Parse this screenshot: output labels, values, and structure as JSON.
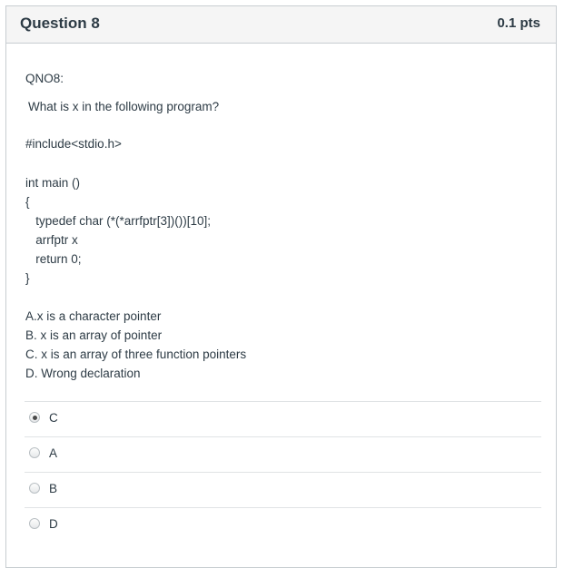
{
  "question": {
    "title": "Question 8",
    "points": "0.1 pts"
  },
  "content": {
    "qno": "QNO8:",
    "prompt": "What is x in the following program?",
    "include": "#include<stdio.h>",
    "code": [
      "int main ()",
      "{",
      "   typedef char (*(*arrfptr[3])())[10];",
      "   arrfptr x",
      "   return 0;",
      "}"
    ],
    "options_text": [
      "A.x is a character pointer",
      "B. x is an array of pointer",
      "C. x is an array of three function pointers",
      "D. Wrong declaration"
    ]
  },
  "answers": [
    {
      "label": "C",
      "selected": true
    },
    {
      "label": "A",
      "selected": false
    },
    {
      "label": "B",
      "selected": false
    },
    {
      "label": "D",
      "selected": false
    }
  ]
}
